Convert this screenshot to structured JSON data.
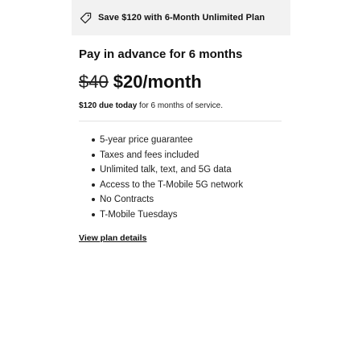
{
  "promo": {
    "icon": "tag-icon",
    "text": "Save $120 with 6-Month Unlimited Plan"
  },
  "plan": {
    "title": "Pay in advance for 6 months",
    "old_price": "$40",
    "new_price": "$20/month",
    "due_amount": "$120 due today",
    "due_suffix": " for 6 months of service."
  },
  "features": [
    "5-year price guarantee",
    "Taxes and fees included",
    "Unlimited talk, text, and 5G data",
    "Access to the T-Mobile 5G network",
    "No Contracts",
    "T-Mobile Tuesdays"
  ],
  "link": {
    "label": "View plan details"
  },
  "colors": {
    "promo_background": "#f2f2f2",
    "text": "#111111",
    "divider": "#e3e3e3"
  }
}
